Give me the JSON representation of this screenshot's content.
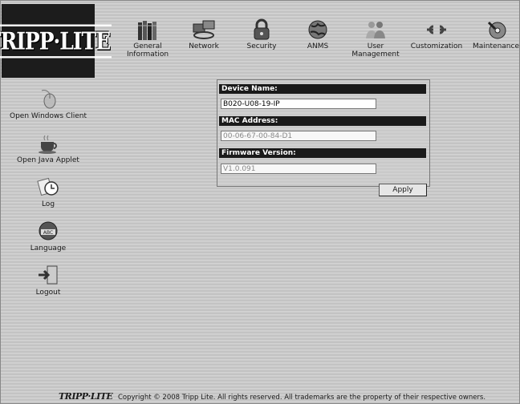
{
  "brand": {
    "logo_text": "TRIPP·LITE"
  },
  "topnav": [
    {
      "label": "General\nInformation",
      "icon": "books-icon"
    },
    {
      "label": "Network",
      "icon": "network-icon"
    },
    {
      "label": "Security",
      "icon": "lock-icon"
    },
    {
      "label": "ANMS",
      "icon": "globe-icon"
    },
    {
      "label": "User\nManagement",
      "icon": "users-icon"
    },
    {
      "label": "Customization",
      "icon": "wrench-icon"
    },
    {
      "label": "Maintenance",
      "icon": "disk-icon"
    }
  ],
  "sidebar": [
    {
      "label": "Open Windows Client",
      "icon": "mouse-icon"
    },
    {
      "label": "Open Java Applet",
      "icon": "coffee-cup-icon"
    },
    {
      "label": "Log",
      "icon": "clock-icon"
    },
    {
      "label": "Language",
      "icon": "language-globe-icon"
    },
    {
      "label": "Logout",
      "icon": "logout-door-icon"
    }
  ],
  "device": {
    "name_label": "Device Name:",
    "name_value": "B020-U08-19-IP",
    "mac_label": "MAC Address:",
    "mac_value": "00-06-67-00-84-D1",
    "fw_label": "Firmware Version:",
    "fw_value": "V1.0.091",
    "apply_label": "Apply"
  },
  "footer": {
    "logo_text": "TRIPP·LITE",
    "copyright": "Copyright © 2008 Tripp Lite. All rights reserved. All trademarks are the property of their respective owners."
  }
}
